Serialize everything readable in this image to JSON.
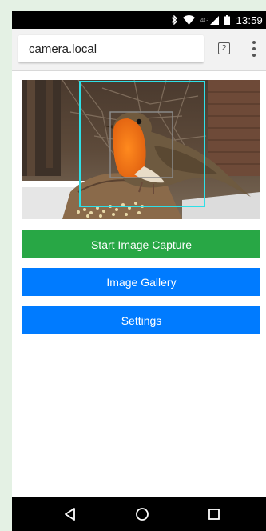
{
  "status_bar": {
    "network_label": "4G",
    "time": "13:59",
    "icons": [
      "bluetooth-icon",
      "wifi-icon",
      "signal-icon",
      "battery-icon"
    ]
  },
  "browser": {
    "url": "camera.local",
    "tab_count": "2",
    "icons": [
      "tab-switcher-icon",
      "overflow-menu-icon"
    ]
  },
  "page": {
    "camera_preview": {
      "subject": "robin on bird feeder",
      "detection_box_color": "#2ee0e8",
      "inner_box_color": "#8a8a8a"
    },
    "buttons": {
      "start_capture": "Start Image Capture",
      "gallery": "Image Gallery",
      "settings": "Settings"
    },
    "colors": {
      "capture_button": "#28a745",
      "gallery_button": "#007bff",
      "settings_button": "#007bff"
    }
  },
  "nav_bar": {
    "icons": [
      "back-icon",
      "home-icon",
      "recents-icon"
    ]
  }
}
